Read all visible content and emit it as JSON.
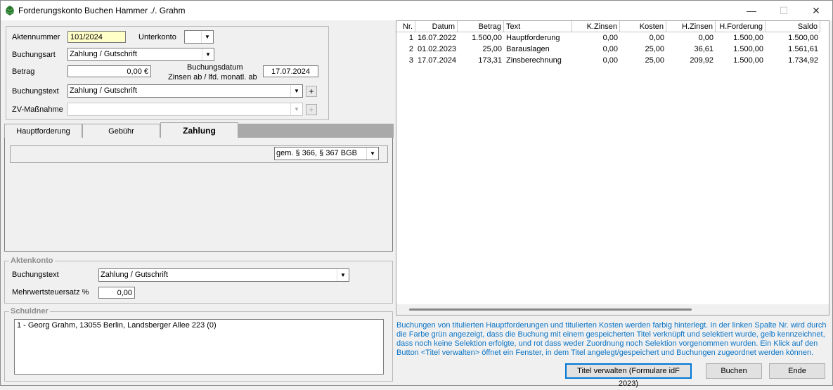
{
  "window": {
    "title": "Forderungskonto Buchen Hammer ./. Grahm",
    "minimize": "—",
    "maximize": "☐",
    "close": "✕"
  },
  "form": {
    "aktennummer_label": "Aktennummer",
    "aktennummer_value": "101/2024",
    "unterkonto_label": "Unterkonto",
    "unterkonto_value": "",
    "buchungsart_label": "Buchungsart",
    "buchungsart_value": "Zahlung / Gutschrift",
    "betrag_label": "Betrag",
    "betrag_value": "0,00 €",
    "buchungsdatum_label": "Buchungsdatum",
    "zinsen_label": "Zinsen ab / lfd. monatl. ab",
    "buchungsdatum_value": "17.07.2024",
    "buchungstext_label": "Buchungstext",
    "buchungstext_value": "Zahlung / Gutschrift",
    "zv_label": "ZV-Maßnahme",
    "zv_value": "",
    "plus": "+"
  },
  "tabs": [
    {
      "label": "Hauptforderung"
    },
    {
      "label": "Gebühr"
    },
    {
      "label": "Zahlung"
    }
  ],
  "zahlung": {
    "verrechnung_value": "gem. § 366, § 367 BGB"
  },
  "aktenkonto": {
    "legend": "Aktenkonto",
    "buchungstext_label": "Buchungstext",
    "buchungstext_value": "Zahlung / Gutschrift",
    "mwst_label": "Mehrwertsteuersatz %",
    "mwst_value": "0,00"
  },
  "schuldner": {
    "legend": "Schuldner",
    "entry": "1 - Georg Grahm, 13055 Berlin, Landsberger Allee 223 (0)"
  },
  "table": {
    "headers": [
      "Nr.",
      "Datum",
      "Betrag",
      "Text",
      "K.Zinsen",
      "Kosten",
      "H.Zinsen",
      "H.Forderung",
      "Saldo"
    ],
    "rows": [
      [
        "1",
        "16.07.2022",
        "1.500,00",
        "Hauptforderung",
        "0,00",
        "0,00",
        "0,00",
        "1.500,00",
        "1.500,00"
      ],
      [
        "2",
        "01.02.2023",
        "25,00",
        "Barauslagen",
        "0,00",
        "25,00",
        "36,61",
        "1.500,00",
        "1.561,61"
      ],
      [
        "3",
        "17.07.2024",
        "173,31",
        "Zinsberechnung",
        "0,00",
        "25,00",
        "209,92",
        "1.500,00",
        "1.734,92"
      ]
    ]
  },
  "info_text": "Buchungen von titulierten Hauptforderungen und titulierten Kosten werden farbig hinterlegt. In der linken Spalte Nr. wird durch die Farbe grün angezeigt, dass die Buchung mit einem gespeicherten Titel verknüpft und selektiert wurde, gelb kennzeichnet, dass noch keine Selektion erfolgte, und rot dass weder Zuordnung noch Selektion vorgenommen wurden. Ein Klick auf den Button <Titel verwalten> öffnet ein Fenster, in dem Titel angelegt/gespeichert und Buchungen zugeordnet werden können.",
  "buttons": {
    "titel": "Titel verwalten (Formulare idF 2023)",
    "buchen": "Buchen",
    "ende": "Ende"
  },
  "colors": {
    "accent": "#0a74c6",
    "highlight_input": "#ffffc8"
  }
}
